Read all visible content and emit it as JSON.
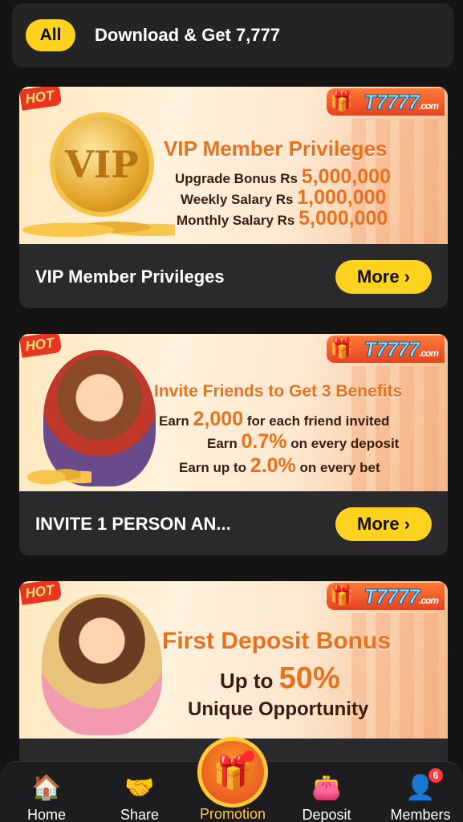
{
  "filter": {
    "active_label": "All",
    "item_label": "Download & Get 7,777"
  },
  "brand": {
    "name": "T7777",
    "suffix": ".com",
    "hot": "HOT"
  },
  "cards": [
    {
      "title": "VIP Member Privileges",
      "button": "More",
      "banner": {
        "headline": "VIP Member Privileges",
        "badge_text": "VIP",
        "lines": [
          {
            "prefix": "Upgrade Bonus Rs",
            "value": "5,000,000",
            "suffix": ""
          },
          {
            "prefix": "Weekly Salary Rs",
            "value": "1,000,000",
            "suffix": ""
          },
          {
            "prefix": "Monthly Salary Rs",
            "value": "5,000,000",
            "suffix": ""
          }
        ]
      }
    },
    {
      "title": "INVITE 1 PERSON AN...",
      "button": "More",
      "banner": {
        "headline": "Invite Friends to Get 3 Benefits",
        "lines": [
          {
            "prefix": "Earn",
            "value": "2,000",
            "suffix": "for each friend invited"
          },
          {
            "prefix": "Earn",
            "value": "0.7%",
            "suffix": "on every deposit"
          },
          {
            "prefix": "Earn up to",
            "value": "2.0%",
            "suffix": "on every bet"
          }
        ]
      }
    },
    {
      "title": "",
      "button": "",
      "banner": {
        "headline": "First Deposit Bonus",
        "lines": [
          {
            "prefix": "Up to",
            "value": "50%",
            "suffix": ""
          },
          {
            "prefix": "Unique Opportunity",
            "value": "",
            "suffix": ""
          }
        ]
      }
    }
  ],
  "nav": {
    "items": [
      {
        "label": "Home",
        "icon": "home-icon"
      },
      {
        "label": "Share",
        "icon": "handshake-icon"
      },
      {
        "label": "Promotion",
        "icon": "gift-icon"
      },
      {
        "label": "Deposit",
        "icon": "wallet-icon"
      },
      {
        "label": "Members",
        "icon": "user-icon",
        "badge": "6"
      }
    ],
    "active": "Promotion"
  },
  "colors": {
    "accent": "#ffd21f",
    "background": "#141414",
    "card": "#2a2a2c",
    "orange_text": "#e8711d"
  }
}
